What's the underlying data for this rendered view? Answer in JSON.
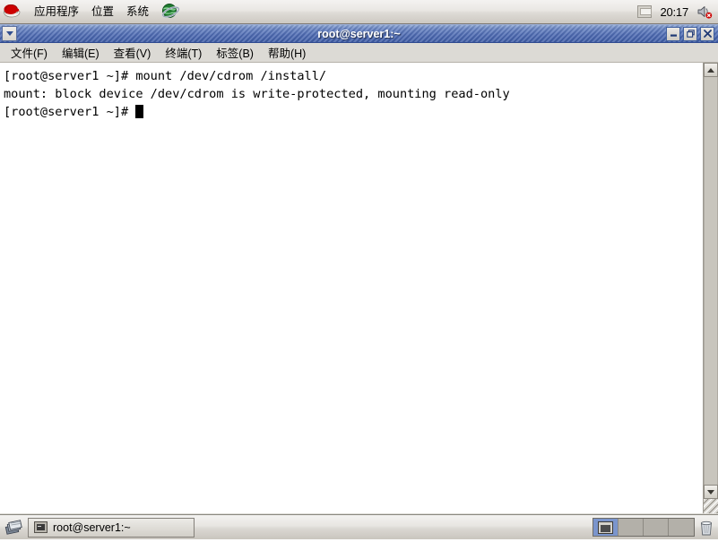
{
  "top_panel": {
    "logo_icon": "redhat-shadowman-icon",
    "menus": [
      {
        "label": "应用程序",
        "name": "applications"
      },
      {
        "label": "位置",
        "name": "places"
      },
      {
        "label": "系统",
        "name": "system"
      }
    ],
    "launchers": [
      {
        "name": "web-browser-icon",
        "icon": "globe-icon"
      }
    ],
    "tray": {
      "applet_icon": "tray-applet-icon",
      "clock": "20:17",
      "volume_icon": "volume-muted-icon"
    }
  },
  "window": {
    "title": "root@server1:~",
    "window_menu_icon": "chevron-down-icon",
    "buttons": {
      "minimize": "_",
      "maximize": "❐",
      "close": "✕"
    },
    "menubar": [
      {
        "label": "文件(F)",
        "name": "file"
      },
      {
        "label": "编辑(E)",
        "name": "edit"
      },
      {
        "label": "查看(V)",
        "name": "view"
      },
      {
        "label": "终端(T)",
        "name": "terminal"
      },
      {
        "label": "标签(B)",
        "name": "tabs"
      },
      {
        "label": "帮助(H)",
        "name": "help"
      }
    ],
    "terminal": {
      "lines": [
        "[root@server1 ~]# mount /dev/cdrom /install/",
        "mount: block device /dev/cdrom is write-protected, mounting read-only",
        "[root@server1 ~]# "
      ],
      "line1": "[root@server1 ~]# mount /dev/cdrom /install/",
      "line2": "mount: block device /dev/cdrom is write-protected, mounting read-only",
      "line3": "[root@server1 ~]# ",
      "foreground": "#000000",
      "background": "#ffffff"
    },
    "scrollbar": {
      "up_arrow": "scroll-up-icon",
      "down_arrow": "scroll-down-icon"
    }
  },
  "bottom_panel": {
    "show_desktop_icon": "show-desktop-icon",
    "tasks": [
      {
        "label": "root@server1:~",
        "icon": "terminal-icon",
        "active": true
      }
    ],
    "workspaces": [
      {
        "name": "workspace-1",
        "active": true,
        "has_window": true
      },
      {
        "name": "workspace-2",
        "active": false,
        "has_window": false
      },
      {
        "name": "workspace-3",
        "active": false,
        "has_window": false
      },
      {
        "name": "workspace-4",
        "active": false,
        "has_window": false
      }
    ],
    "trash_icon": "trash-icon"
  },
  "colors": {
    "titlebar_active": "#4f6cb4",
    "panel_bg": "#dcdad5",
    "terminal_bg": "#ffffff",
    "workspace_active": "#7b95cc"
  }
}
